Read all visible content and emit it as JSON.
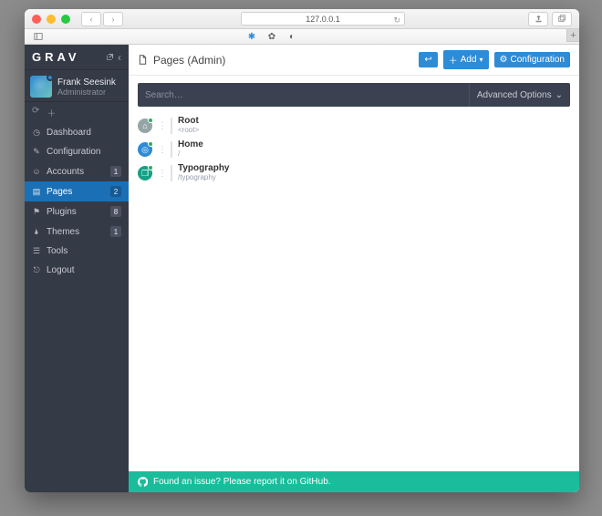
{
  "browser": {
    "address": "127.0.0.1"
  },
  "brand": {
    "name": "GRAV"
  },
  "user": {
    "name": "Frank Seesink",
    "role": "Administrator"
  },
  "sidebar": {
    "items": [
      {
        "icon": "gauge-icon",
        "label": "Dashboard",
        "badge": null
      },
      {
        "icon": "wrench-icon",
        "label": "Configuration",
        "badge": null
      },
      {
        "icon": "users-icon",
        "label": "Accounts",
        "badge": "1"
      },
      {
        "icon": "file-icon",
        "label": "Pages",
        "badge": "2"
      },
      {
        "icon": "plug-icon",
        "label": "Plugins",
        "badge": "8"
      },
      {
        "icon": "drop-icon",
        "label": "Themes",
        "badge": "1"
      },
      {
        "icon": "briefcase-icon",
        "label": "Tools",
        "badge": null
      },
      {
        "icon": "logout-icon",
        "label": "Logout",
        "badge": null
      }
    ]
  },
  "header": {
    "title": "Pages (Admin)",
    "back_label": "",
    "add_label": "Add",
    "config_label": "Configuration"
  },
  "search": {
    "placeholder": "Search…",
    "advanced_label": "Advanced Options"
  },
  "pages": [
    {
      "title": "Root",
      "path": "<root>"
    },
    {
      "title": "Home",
      "path": "/"
    },
    {
      "title": "Typography",
      "path": "/typography"
    }
  ],
  "footer": {
    "text": "Found an issue? Please report it on GitHub."
  }
}
